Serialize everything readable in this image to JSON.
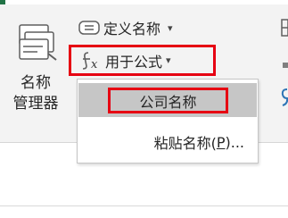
{
  "ribbon": {
    "name_manager": {
      "label_line1": "名称",
      "label_line2": "管理器",
      "icon": "name-manager-icon"
    },
    "define_name": {
      "label": "定义名称",
      "caret": "▾",
      "icon": "define-name-icon"
    },
    "use_in_formula": {
      "label": "用于公式",
      "caret": "▾",
      "icon": "fx-icon"
    }
  },
  "dropdown": {
    "items": [
      {
        "label": "公司名称"
      },
      {
        "label": "粘贴名称(",
        "accel": "P",
        "suffix": ")..."
      }
    ]
  },
  "colors": {
    "highlight_border": "#e60012",
    "selected_item_bg": "#c6c6c6",
    "accent_green": "#217346"
  }
}
